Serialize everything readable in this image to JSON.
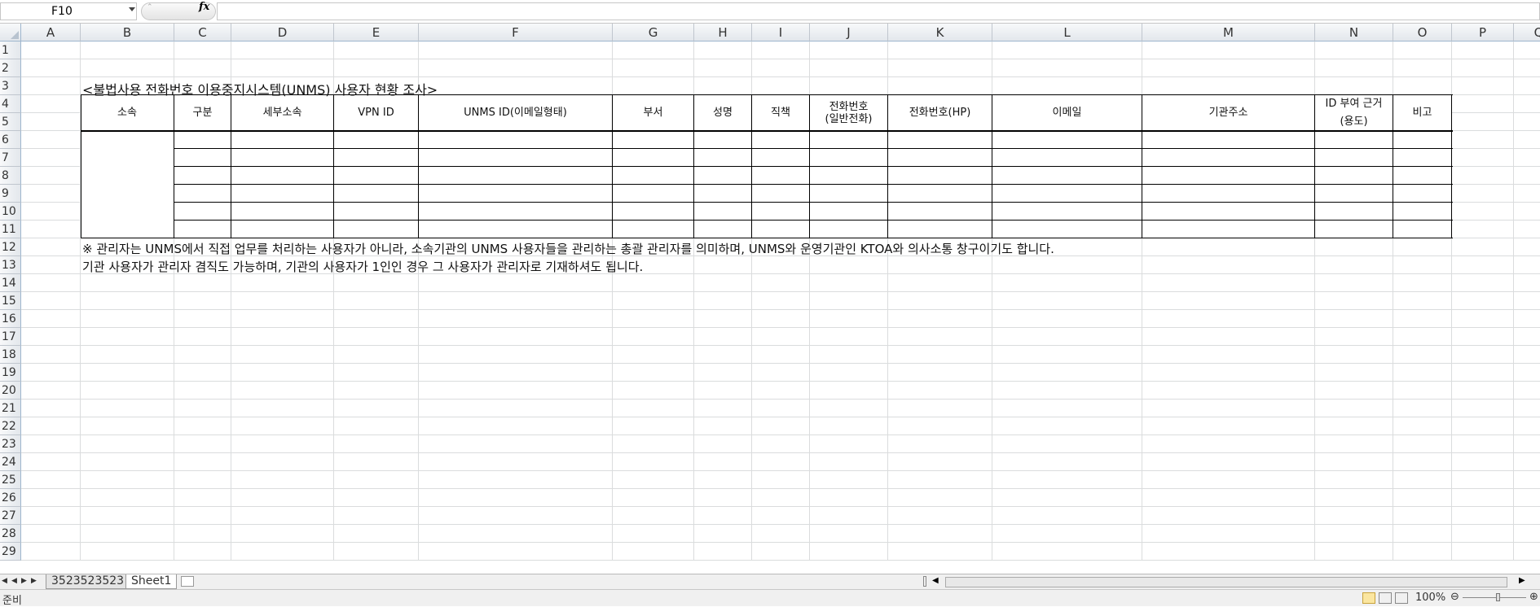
{
  "formula_bar": {
    "name_box": "F10",
    "fx_label": "fx",
    "formula": ""
  },
  "columns": [
    "A",
    "B",
    "C",
    "D",
    "E",
    "F",
    "G",
    "H",
    "I",
    "J",
    "K",
    "L",
    "M",
    "N",
    "O",
    "P",
    "Q"
  ],
  "rows": [
    "1",
    "2",
    "3",
    "4",
    "5",
    "6",
    "7",
    "8",
    "9",
    "10",
    "11",
    "12",
    "13",
    "14",
    "15",
    "16",
    "17",
    "18",
    "19",
    "20",
    "21",
    "22",
    "23",
    "24",
    "25",
    "26",
    "27",
    "28",
    "29"
  ],
  "sheet": {
    "title": "<불법사용 전화번호 이용중지시스템(UNMS) 사용자 현황 조사>",
    "headers": {
      "affiliation": "소속",
      "category": "구분",
      "sub_affiliation": "세부소속",
      "vpn_id": "VPN ID",
      "unms_id": "UNMS ID(이메일형태)",
      "department": "부서",
      "name": "성명",
      "position": "직책",
      "phone_line1": "전화번호",
      "phone_line2": "(일반전화)",
      "mobile": "전화번호(HP)",
      "email": "이메일",
      "address": "기관주소",
      "id_basis_line1": "ID 부여 근거",
      "id_basis_line2": "(용도)",
      "remarks": "비고"
    },
    "note1": "※ 관리자는 UNMS에서 직접 업무를 처리하는 사용자가 아니라, 소속기관의 UNMS 사용자들을 관리하는 총괄 관리자를 의미하며, UNMS와 운영기관인 KTOA와 의사소통 창구이기도 합니다.",
    "note2": "기관 사용자가 관리자 겸직도 가능하며, 기관의 사용자가 1인인 경우 그 사용자가 관리자로 기재하셔도 됩니다."
  },
  "tabs": [
    {
      "label": "3523523523",
      "active": false
    },
    {
      "label": "Sheet1",
      "active": true
    }
  ],
  "status": {
    "ready": "준비",
    "zoom": "100%"
  }
}
